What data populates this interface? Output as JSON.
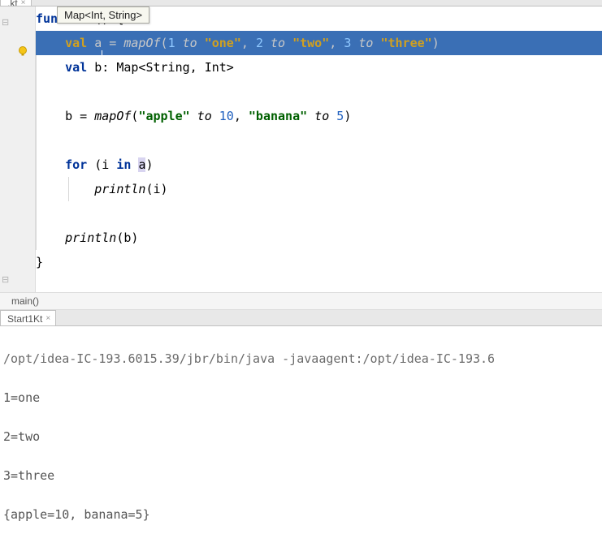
{
  "file_tab": {
    "name": ".kt",
    "close": "×"
  },
  "tooltip": "Map<Int, String>",
  "code": {
    "l1": {
      "kw": "fun",
      "rest": " main() {"
    },
    "l2": {
      "ind": "    ",
      "kw": "val",
      "var": " a",
      "eq": " = ",
      "fn": "mapOf",
      "p1a": "(",
      "n1": "1",
      "to1": " to ",
      "s1": "\"one\"",
      "c1": ", ",
      "n2": "2",
      "to2": " to ",
      "s2": "\"two\"",
      "c2": ", ",
      "n3": "3",
      "to3": " to ",
      "s3": "\"three\"",
      "p1b": ")"
    },
    "l3": {
      "ind": "    ",
      "kw": "val",
      "rest": " b: Map<String, Int>"
    },
    "l5": {
      "ind": "    ",
      "pre": "b = ",
      "fn": "mapOf",
      "p": "(",
      "s1": "\"apple\"",
      "to1": " to ",
      "n1": "10",
      "c1": ", ",
      "s2": "\"banana\"",
      "to2": " to ",
      "n2": "5",
      "p2": ")"
    },
    "l7": {
      "ind": "    ",
      "kw1": "for",
      "p1": " (i ",
      "kw2": "in",
      "a": " a",
      "p2": ")"
    },
    "l8": {
      "ind": "        ",
      "fn": "println",
      "rest": "(i)"
    },
    "l10": {
      "ind": "    ",
      "fn": "println",
      "rest": "(b)"
    },
    "l11": "}"
  },
  "breadcrumb": "main()",
  "run_tab": {
    "name": "Start1Kt",
    "close": "×"
  },
  "console": {
    "cmd": "/opt/idea-IC-193.6015.39/jbr/bin/java -javaagent:/opt/idea-IC-193.6",
    "o1": "1=one",
    "o2": "2=two",
    "o3": "3=three",
    "o4": "{apple=10, banana=5}"
  }
}
